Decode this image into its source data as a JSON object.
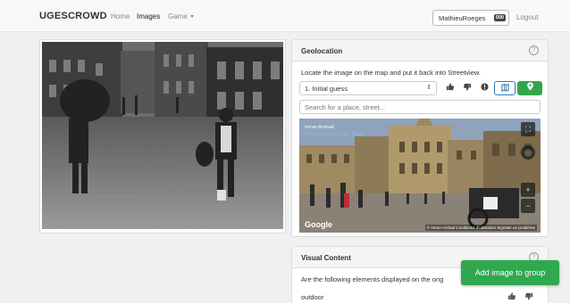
{
  "navbar": {
    "brand": "UGESCROWD",
    "links": [
      "Home",
      "Images",
      "Game"
    ],
    "user": "MathieuRoeges",
    "user_badge": "500",
    "logout": "Logout"
  },
  "geolocation": {
    "title": "Geolocation",
    "description": "Locate the image on the map and put it back into Streetview.",
    "guess_selected": "1. Initial guess",
    "search_placeholder": "Search for a place, street...",
    "streetview": {
      "author": "Imran Arshad",
      "source_link": "Afficher dans Google Maps",
      "logo": "Google",
      "credits": "© Imran Arshad   Conditions d'utilisation   Signaler un problème"
    },
    "icons": [
      "thumbs-up-icon",
      "thumbs-down-icon",
      "alert-icon",
      "flag-icon",
      "map-marker-icon"
    ]
  },
  "visual_content": {
    "title": "Visual Content",
    "question": "Are the following elements displayed on the orig",
    "items": [
      "outdoor"
    ]
  },
  "add_button": "Add image to group",
  "colors": {
    "primary_green": "#2fa84f",
    "flag_blue": "#337ab7",
    "navbar_bg": "#f8f8f8"
  }
}
